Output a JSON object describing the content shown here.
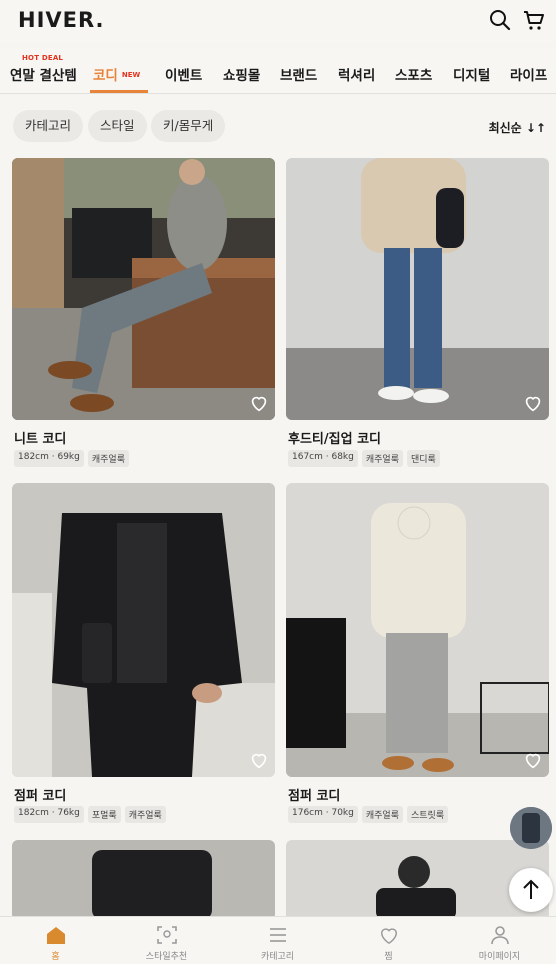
{
  "header": {
    "logo": "HIVER."
  },
  "tabs": [
    {
      "label": "연말 결산템",
      "badge": "HOT DEAL"
    },
    {
      "label": "코디",
      "badge": "NEW"
    },
    {
      "label": "이벤트"
    },
    {
      "label": "쇼핑몰"
    },
    {
      "label": "브랜드"
    },
    {
      "label": "럭셔리"
    },
    {
      "label": "스포츠"
    },
    {
      "label": "디지털"
    },
    {
      "label": "라이프"
    }
  ],
  "filters": {
    "chips": [
      "카테고리",
      "스타일",
      "키/몸무게"
    ],
    "sort": "최신순 ↓↑"
  },
  "cards": [
    {
      "title": "니트 코디",
      "tags": [
        "182cm · 69kg",
        "캐주얼룩"
      ]
    },
    {
      "title": "후드티/집업 코디",
      "tags": [
        "167cm · 68kg",
        "캐주얼룩",
        "댄디룩"
      ]
    },
    {
      "title": "점퍼 코디",
      "tags": [
        "182cm · 76kg",
        "포멀룩",
        "캐주얼룩"
      ]
    },
    {
      "title": "점퍼 코디",
      "tags": [
        "176cm · 70kg",
        "캐주얼룩",
        "스트릿룩"
      ]
    }
  ],
  "bottom_nav": [
    {
      "label": "홈",
      "icon": "home-icon"
    },
    {
      "label": "스타일추천",
      "icon": "scan-icon"
    },
    {
      "label": "카테고리",
      "icon": "menu-icon"
    },
    {
      "label": "찜",
      "icon": "heart-icon"
    },
    {
      "label": "마이페이지",
      "icon": "person-icon"
    }
  ],
  "colors": {
    "accent": "#e8833a",
    "hot": "#e1331f",
    "background": "#f6f5f2"
  }
}
